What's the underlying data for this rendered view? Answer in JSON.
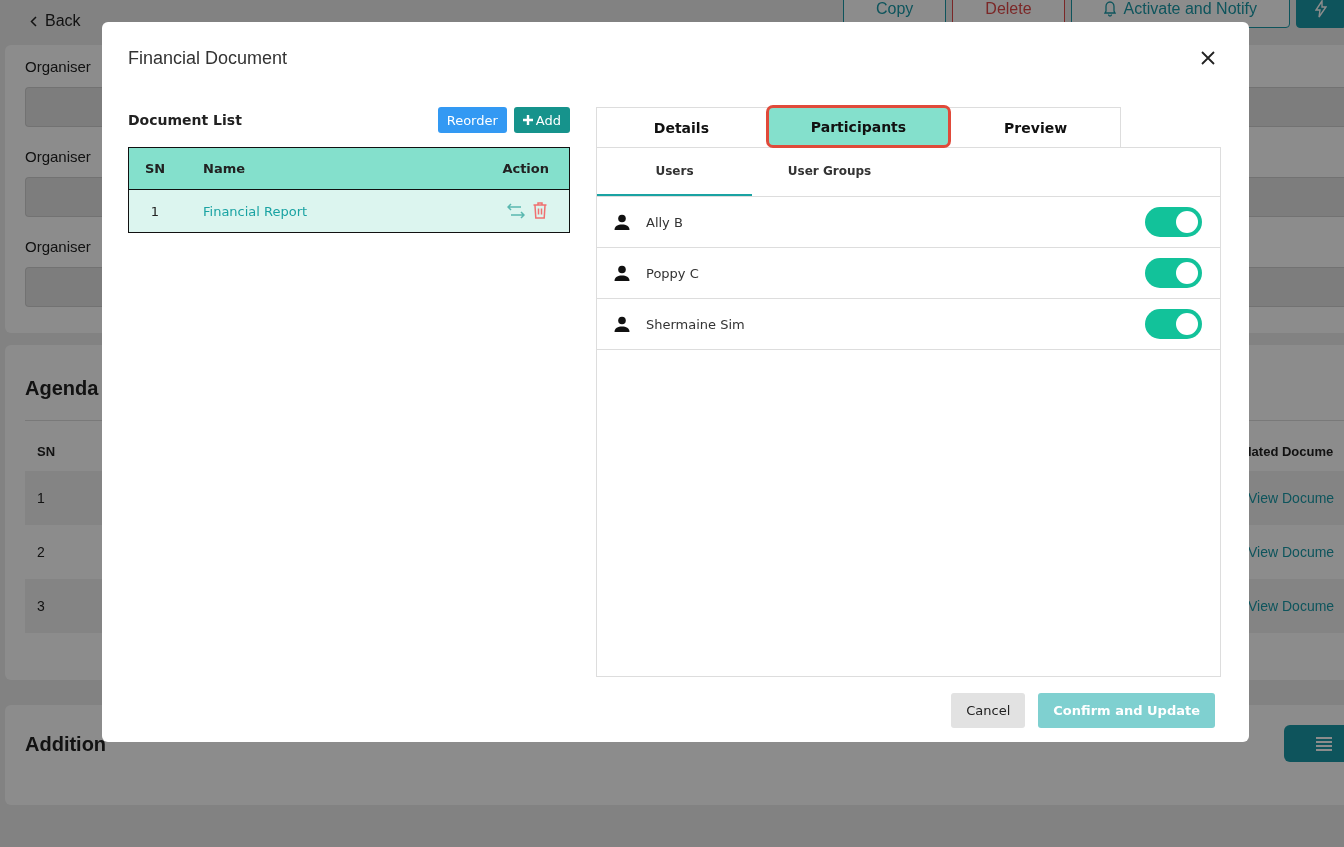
{
  "page": {
    "back": "Back",
    "actions": [
      {
        "kind": "outline",
        "label": "Copy"
      },
      {
        "kind": "danger",
        "label": "Delete"
      },
      {
        "kind": "notify",
        "label": "Activate and Notify"
      },
      {
        "kind": "primary"
      }
    ],
    "organiser_fields": [
      {
        "label": "Organiser"
      },
      {
        "label": "Organiser"
      },
      {
        "label": "Organiser"
      }
    ],
    "agenda": {
      "title": "Agenda",
      "columns": [
        "SN",
        "lated Docume"
      ],
      "rows": [
        {
          "sn": "1",
          "link": "View Docume"
        },
        {
          "sn": "2",
          "link": "View Docume"
        },
        {
          "sn": "3",
          "link": "View Docume"
        }
      ]
    },
    "additional": {
      "title": "Addition"
    }
  },
  "dialog": {
    "title": "Financial Document",
    "document_list": {
      "title": "Document List",
      "reorder": "Reorder",
      "add": "Add",
      "columns": [
        "SN",
        "Name",
        "Action"
      ],
      "rows": [
        {
          "sn": "1",
          "name": "Financial Report"
        }
      ]
    },
    "tabs": [
      {
        "label": "Details",
        "selected": false
      },
      {
        "label": "Participants",
        "selected": true
      },
      {
        "label": "Preview",
        "selected": false
      }
    ],
    "subtabs": [
      {
        "label": "Users",
        "selected": true
      },
      {
        "label": "User Groups",
        "selected": false
      }
    ],
    "participants": [
      {
        "name": "Ally B",
        "on": true
      },
      {
        "name": "Poppy C",
        "on": true
      },
      {
        "name": "Shermaine Sim",
        "on": true
      }
    ],
    "buttons": [
      {
        "kind": "cancel",
        "label": "Cancel"
      },
      {
        "kind": "confirm",
        "label": "Confirm and Update",
        "disabled": true
      }
    ]
  }
}
